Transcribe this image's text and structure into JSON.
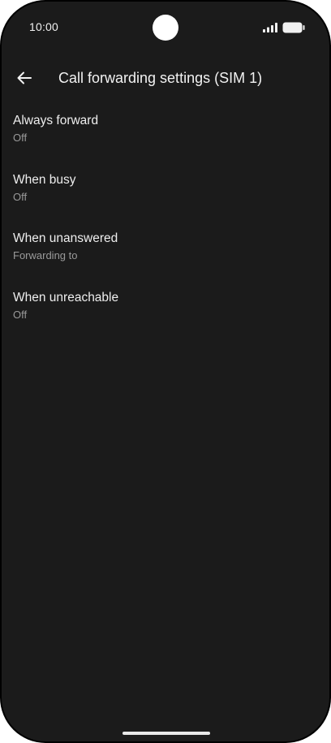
{
  "status_bar": {
    "time": "10:00",
    "signal_icon": "cellular-signal-icon",
    "battery_icon": "battery-full-icon"
  },
  "app_bar": {
    "back_icon": "arrow-left-icon",
    "title": "Call forwarding settings (SIM 1)"
  },
  "settings": [
    {
      "title": "Always forward",
      "summary": "Off"
    },
    {
      "title": "When busy",
      "summary": "Off"
    },
    {
      "title": "When unanswered",
      "summary": "Forwarding to"
    },
    {
      "title": "When unreachable",
      "summary": "Off"
    }
  ],
  "colors": {
    "background": "#1b1b1b",
    "frame": "#000000",
    "title_text": "#eeeeee",
    "summary_text": "#9a9a9a"
  }
}
